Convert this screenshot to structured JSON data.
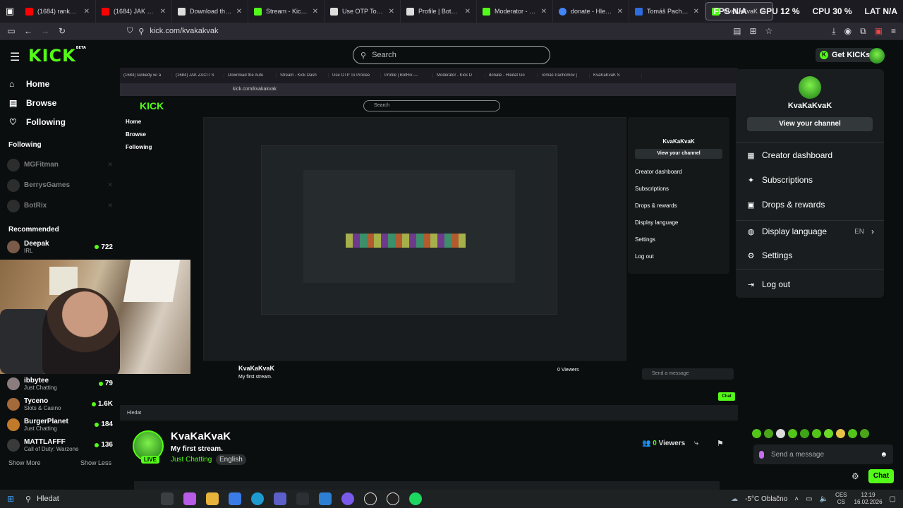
{
  "browser": {
    "tabs": [
      {
        "title": "(1684) rankedy w/ a",
        "color": "#ff0000"
      },
      {
        "title": "(1684) JAK ZAČÍT S",
        "color": "#ff0000"
      },
      {
        "title": "Download the Autu",
        "color": "#dddddd"
      },
      {
        "title": "Stream - Kick Dash",
        "color": "#53fc18"
      },
      {
        "title": "Use OTP To Procee",
        "color": "#dddddd"
      },
      {
        "title": "Profile | BotRix —",
        "color": "#dddddd"
      },
      {
        "title": "Moderator - Kick D",
        "color": "#53fc18"
      },
      {
        "title": "donate - Hledat Go",
        "color": "#4285f4"
      },
      {
        "title": "Tomáš Pachomov |",
        "color": "#2d6cdf"
      },
      {
        "title": "KvaKaKvaK S",
        "color": "#53fc18"
      }
    ],
    "perf": {
      "fps": "FPS N/A",
      "gpu_label": "GPU",
      "gpu": "12 %",
      "cpu_label": "CPU",
      "cpu": "30 %",
      "lat_label": "LAT",
      "lat": "N/A"
    },
    "url": "kick.com/kvakakvak"
  },
  "header": {
    "logo": "KICK",
    "logo_sup": "BETA",
    "search_placeholder": "Search",
    "get_kicks": "Get KICKs"
  },
  "sidebar": {
    "nav": [
      {
        "label": "Home",
        "icon": "home-icon"
      },
      {
        "label": "Browse",
        "icon": "browse-icon"
      },
      {
        "label": "Following",
        "icon": "heart-icon"
      }
    ],
    "following_header": "Following",
    "following": [
      {
        "name": "MGFitman"
      },
      {
        "name": "BerrysGames"
      },
      {
        "name": "BotRix"
      }
    ],
    "recommended_header": "Recommended",
    "recommended_top": {
      "name": "Deepak",
      "category": "IRL",
      "viewers": "722"
    },
    "recommended": [
      {
        "name": "ibbytee",
        "category": "Just Chatting",
        "viewers": "79"
      },
      {
        "name": "Tyceno",
        "category": "Slots & Casino",
        "viewers": "1.6K"
      },
      {
        "name": "BurgerPlanet",
        "category": "Just Chatting",
        "viewers": "184"
      },
      {
        "name": "MATTLAFFF",
        "category": "Call of Duty: Warzone",
        "viewers": "136"
      }
    ],
    "show_more": "Show More",
    "show_less": "Show Less"
  },
  "capture": {
    "url": "kick.com/kvakakvak",
    "search": "Search",
    "nav": [
      "Home",
      "Browse",
      "Following"
    ],
    "menu_user": "KvaKaKvaK",
    "menu_button": "View your channel",
    "menu_items": [
      "Creator dashboard",
      "Subscriptions",
      "Drops & rewards",
      "Display language",
      "Settings",
      "Log out"
    ],
    "stream_name": "KvaKaKvaK",
    "stream_title": "My first stream.",
    "viewers": "0 Viewers",
    "chat_placeholder": "Send a message",
    "chat_button": "Chat",
    "taskbar_search": "Hledat"
  },
  "channel": {
    "name": "KvaKaKvaK",
    "title": "My first stream.",
    "category": "Just Chatting",
    "language": "English",
    "live": "LIVE",
    "viewers_count": "0",
    "viewers_label": "Viewers"
  },
  "chat": {
    "placeholder": "Send a message",
    "button": "Chat"
  },
  "menu": {
    "username": "KvaKaKvaK",
    "view_channel": "View your channel",
    "items": [
      {
        "label": "Creator dashboard",
        "icon": "dashboard-icon"
      },
      {
        "label": "Subscriptions",
        "icon": "sparkle-icon"
      },
      {
        "label": "Drops & rewards",
        "icon": "gift-icon"
      },
      {
        "label": "Display language",
        "icon": "globe-icon",
        "value": "EN"
      },
      {
        "label": "Settings",
        "icon": "gear-icon"
      },
      {
        "label": "Log out",
        "icon": "logout-icon"
      }
    ]
  },
  "taskbar": {
    "search": "Hledat",
    "weather": "-5°C Oblačno",
    "lang": "CES\nCS",
    "lang_top": "CES",
    "lang_bottom": "CS",
    "time": "12:19",
    "date": "16.02.2026"
  }
}
